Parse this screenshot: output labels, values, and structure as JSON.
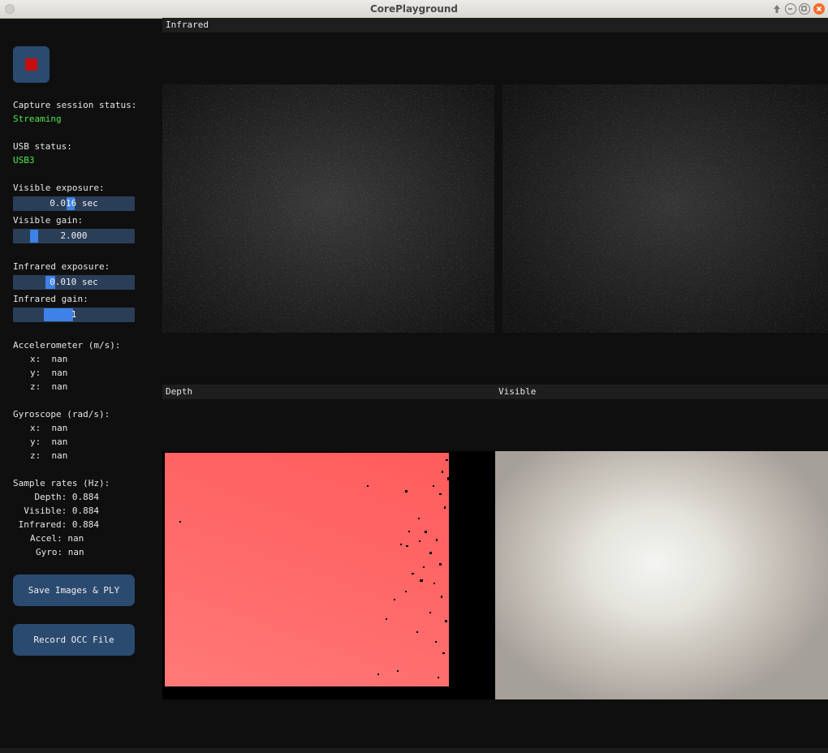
{
  "window": {
    "title": "CorePlayground"
  },
  "sidebar": {
    "capture_label": "Capture session status:",
    "capture_value": "Streaming",
    "usb_label": "USB status:",
    "usb_value": "USB3",
    "visible_exposure_label": "Visible exposure:",
    "visible_exposure_value": "0.016 sec",
    "visible_gain_label": "Visible gain:",
    "visible_gain_value": "2.000",
    "infrared_exposure_label": "Infrared exposure:",
    "infrared_exposure_value": "0.010 sec",
    "infrared_gain_label": "Infrared gain:",
    "infrared_gain_value": "1",
    "accel_label": "Accelerometer (m/s):",
    "accel_x": "x:  nan",
    "accel_y": "y:  nan",
    "accel_z": "z:  nan",
    "gyro_label": "Gyroscope (rad/s):",
    "gyro_x": "x:  nan",
    "gyro_y": "y:  nan",
    "gyro_z": "z:  nan",
    "rates_label": "Sample rates (Hz):",
    "rate_depth": "Depth: 0.884",
    "rate_visible": "Visible: 0.884",
    "rate_infrared": "Infrared: 0.884",
    "rate_accel": "Accel: nan",
    "rate_gyro": "Gyro: nan",
    "save_button": "Save Images & PLY",
    "record_button": "Record OCC File"
  },
  "panels": {
    "infrared": "Infrared",
    "depth": "Depth",
    "visible": "Visible"
  },
  "colors": {
    "accent": "#3d82e6",
    "button": "#2b4a70",
    "status_ok": "#4fe64f",
    "stop": "#c40f0f"
  }
}
